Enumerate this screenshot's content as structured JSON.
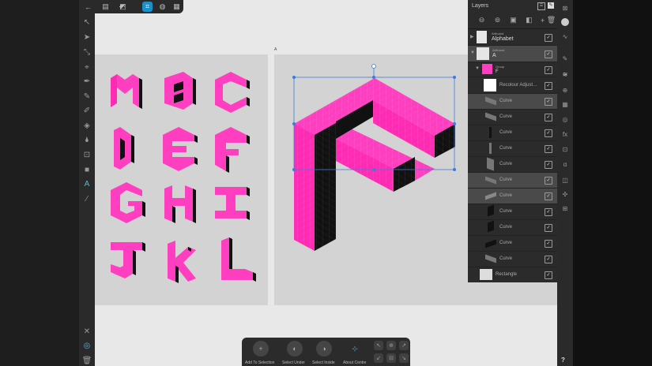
{
  "layers_panel": {
    "title": "Layers",
    "rows": [
      {
        "kind": "Artboard",
        "name": "Alphabet",
        "checked": "✓"
      },
      {
        "kind": "Artboard",
        "name": "A",
        "checked": "✓"
      },
      {
        "kind": "Group",
        "name": "F",
        "checked": "✓"
      },
      {
        "name": "Recolour Adjust…",
        "checked": "✓"
      },
      {
        "name": "Curve",
        "checked": "✓"
      },
      {
        "name": "Curve",
        "checked": "✓"
      },
      {
        "name": "Curve",
        "checked": "✓"
      },
      {
        "name": "Curve",
        "checked": "✓"
      },
      {
        "name": "Curve",
        "checked": "✓"
      },
      {
        "name": "Curve",
        "checked": "✓"
      },
      {
        "name": "Curve",
        "checked": "✓"
      },
      {
        "name": "Curve",
        "checked": "✓"
      },
      {
        "name": "Curve",
        "checked": "✓"
      },
      {
        "name": "Curve",
        "checked": "✓"
      },
      {
        "name": "Curve",
        "checked": "✓"
      },
      {
        "name": "Rectangle",
        "checked": "✓"
      }
    ]
  },
  "artboard_label": "A",
  "bottom_bar": {
    "add_to_selection": "Add To Selection",
    "select_under": "Select Under",
    "select_inside": "Select Inside",
    "about_centre": "About Centre"
  },
  "help": "?",
  "colors": {
    "accent": "#1d8fc7",
    "letter": "#ff3fc0",
    "selection": "#3a7be0"
  }
}
